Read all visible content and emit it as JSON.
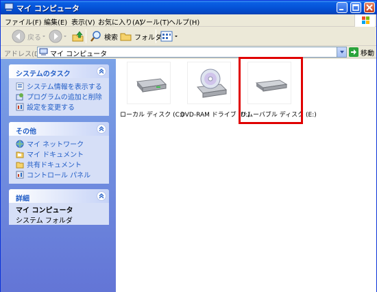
{
  "window": {
    "title": "マイ コンピュータ",
    "accent": "#0553d8",
    "highlight": "#e00000"
  },
  "menu": {
    "items": [
      {
        "label": "ファイル(F)"
      },
      {
        "label": "編集(E)"
      },
      {
        "label": "表示(V)"
      },
      {
        "label": "お気に入り(A)"
      },
      {
        "label": "ツール(T)"
      },
      {
        "label": "ヘルプ(H)"
      }
    ]
  },
  "toolbar": {
    "back_label": "戻る",
    "search_label": "検索",
    "folder_label": "フォルダ"
  },
  "address": {
    "label": "アドレス(D)",
    "value": "マイ コンピュータ",
    "go_label": "移動"
  },
  "panels": {
    "tasks": {
      "title": "システムのタスク",
      "items": [
        {
          "label": "システム情報を表示する",
          "icon": "system-info-icon"
        },
        {
          "label": "プログラムの追加と削除",
          "icon": "add-remove-programs-icon"
        },
        {
          "label": "設定を変更する",
          "icon": "control-panel-settings-icon"
        }
      ]
    },
    "other": {
      "title": "その他",
      "items": [
        {
          "label": "マイ ネットワーク",
          "icon": "network-icon"
        },
        {
          "label": "マイ ドキュメント",
          "icon": "documents-folder-icon"
        },
        {
          "label": "共有ドキュメント",
          "icon": "shared-folder-icon"
        },
        {
          "label": "コントロール パネル",
          "icon": "control-panel-icon"
        }
      ]
    },
    "details": {
      "title": "詳細",
      "name": "マイ コンピュータ",
      "type": "システム フォルダ"
    }
  },
  "drives": [
    {
      "label": "ローカル ディスク (C:)",
      "icon": "hard-disk-icon"
    },
    {
      "label": "DVD-RAM ドライブ (D:)",
      "icon": "dvd-drive-icon"
    },
    {
      "label": "リムーバブル ディスク (E:)",
      "icon": "removable-disk-icon"
    }
  ]
}
